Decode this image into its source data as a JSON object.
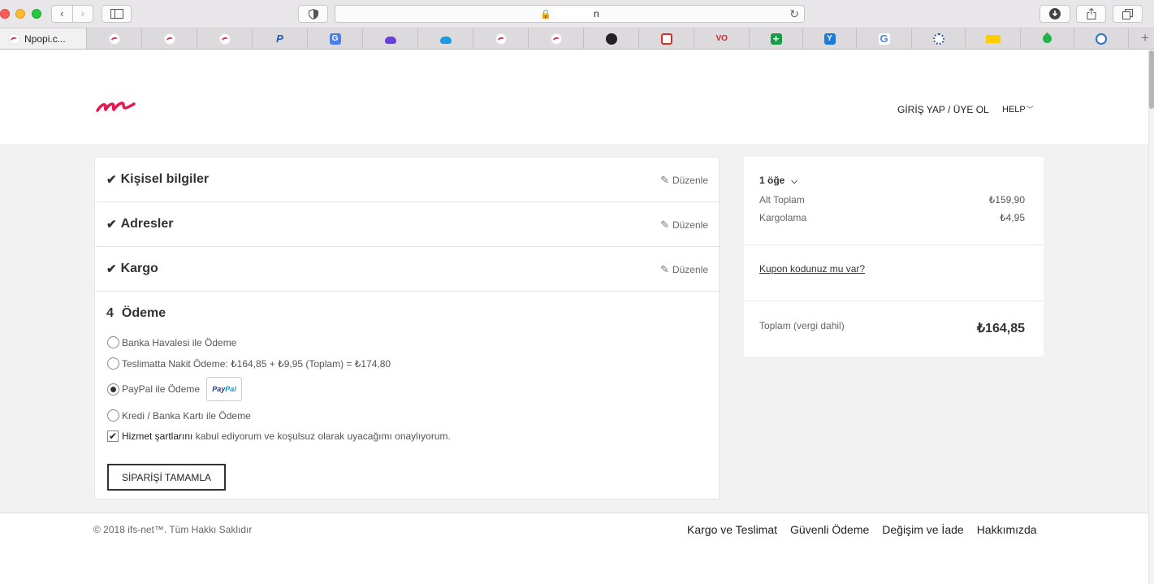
{
  "browser": {
    "url_text": "n",
    "bookmarks": {
      "first_tab_label": "Npopi.c..."
    }
  },
  "header": {
    "login_label": "GİRİŞ YAP / ÜYE OL",
    "help_label": "HELP"
  },
  "checkout": {
    "steps": [
      {
        "title": "Kişisel bilgiler",
        "edit_label": "Düzenle"
      },
      {
        "title": "Adresler",
        "edit_label": "Düzenle"
      },
      {
        "title": "Kargo",
        "edit_label": "Düzenle"
      }
    ],
    "payment": {
      "step_number": "4",
      "title": "Ödeme",
      "options": [
        {
          "label": "Banka Havalesi ile Ödeme",
          "selected": false
        },
        {
          "label": "Teslimatta Nakit Ödeme: ₺164,85 + ₺9,95 (Toplam) = ₺174,80",
          "selected": false
        },
        {
          "label": "PayPal ile Ödeme",
          "selected": true
        },
        {
          "label": "Kredi / Banka Kartı ile Ödeme",
          "selected": false
        }
      ],
      "paypal_badge": {
        "pay": "Pay",
        "pal": "Pal"
      },
      "terms": {
        "link": "Hizmet şartlarını",
        "rest": "kabul ediyorum ve koşulsuz olarak uyacağımı onaylıyorum.",
        "checked": true
      },
      "submit_label": "SİPARİŞİ TAMAMLA"
    }
  },
  "summary": {
    "items_label": "1 öğe",
    "subtotal_label": "Alt Toplam",
    "subtotal_value": "₺159,90",
    "shipping_label": "Kargolama",
    "shipping_value": "₺4,95",
    "coupon_label": "Kupon kodunuz mu var?",
    "total_label": "Toplam (vergi dahil)",
    "total_value": "₺164,85"
  },
  "footer": {
    "copyright": "© 2018 ifs-net™. Tüm Hakkı Saklıdır",
    "links": [
      "Kargo ve Teslimat",
      "Güvenli Ödeme",
      "Değişim ve İade",
      "Hakkımızda"
    ]
  },
  "colors": {
    "brand": "#e5194d",
    "page_bg": "#f2f2f2"
  }
}
